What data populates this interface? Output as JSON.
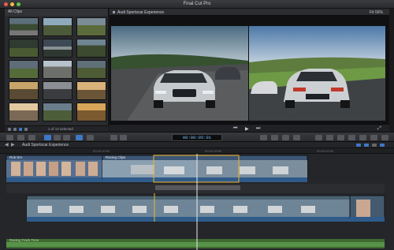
{
  "app": {
    "title": "Final Cut Pro"
  },
  "window": {
    "colors": {
      "close": "#ee5b50",
      "minimize": "#f1bd3c",
      "zoom": "#5ec64a"
    }
  },
  "browser": {
    "header": "All Clips",
    "footer_count": "1 of 13 selected",
    "thumbnails": [
      "clip-1",
      "clip-2",
      "clip-3",
      "clip-4",
      "clip-5",
      "clip-6",
      "clip-7",
      "clip-8",
      "clip-9",
      "clip-10",
      "clip-11",
      "clip-12",
      "clip-13",
      "clip-14",
      "clip-15"
    ]
  },
  "viewer": {
    "title": "Audi Sportscar Experience",
    "zoom": "Fit",
    "zoom_percent": "56%"
  },
  "toolbar": {
    "timecode": "00:00:05:01",
    "accent": "#3c78c6"
  },
  "timeline": {
    "project_name": "Audi Sportscar Experience",
    "ruler_labels": [
      "00:00:10:00",
      "00:00:15:00",
      "00:00:20:00"
    ],
    "primary_clip_labels": [
      "Rok Sm",
      "Racing Clips"
    ],
    "music_label": "Racing Track Tone"
  }
}
